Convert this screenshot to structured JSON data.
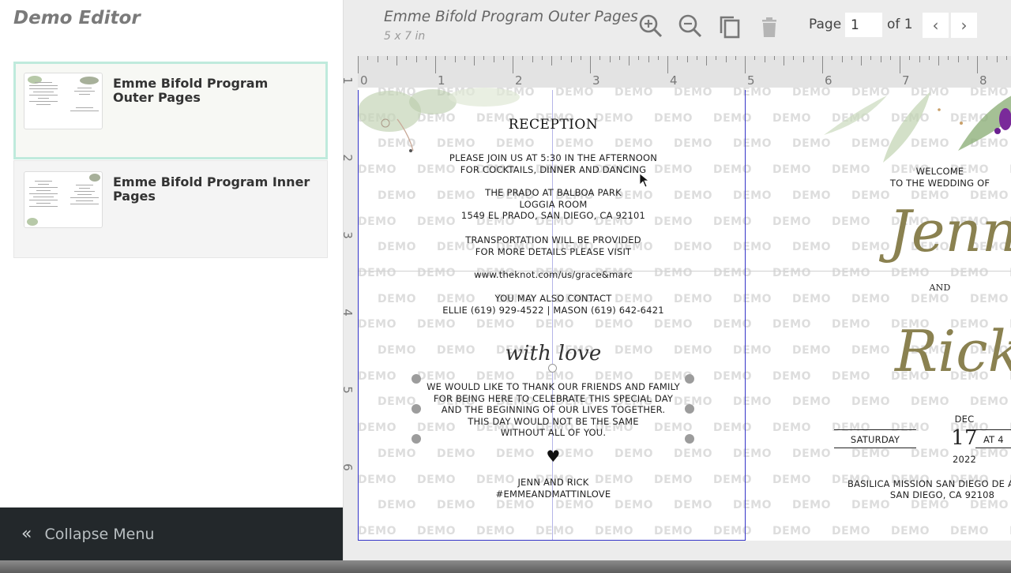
{
  "sidebar": {
    "title": "Demo Editor",
    "designs": [
      {
        "name": "Emme Bifold Program Outer Pages",
        "active": true
      },
      {
        "name": "Emme Bifold Program Inner Pages",
        "active": false
      }
    ],
    "collapse_label": "Collapse Menu",
    "collapse_icon": "double-chevron-left-icon"
  },
  "toolbar": {
    "doc_title": "Emme Bifold Program Outer Pages",
    "doc_size": "5 x 7 in",
    "icons": [
      "zoom-in-icon",
      "zoom-out-icon",
      "duplicate-icon",
      "trash-icon"
    ],
    "page_label": "Page",
    "page_value": "1",
    "page_of": "of 1",
    "prev": "‹",
    "next": "›"
  },
  "ruler": {
    "h_labels": [
      "0",
      "1",
      "2",
      "3",
      "4",
      "5",
      "6",
      "7",
      "8"
    ],
    "v_labels": [
      "1",
      "2",
      "3",
      "4",
      "5",
      "6"
    ]
  },
  "watermark": "DEMO",
  "left_page": {
    "heading": "RECEPTION",
    "invite": [
      "PLEASE JOIN US AT 5:30 IN THE AFTERNOON",
      "FOR COCKTAILS, DINNER AND DANCING"
    ],
    "venue": [
      "THE PRADO AT BALBOA PARK",
      "LOGGIA ROOM",
      "1549 EL PRADO, SAN DIEGO, CA 92101"
    ],
    "transport": [
      "TRANSPORTATION WILL BE PROVIDED",
      "FOR MORE DETAILS PLEASE VISIT"
    ],
    "url": "www.theknot.com/us/grace&marc",
    "contact": [
      "YOU MAY ALSO CONTACT",
      "ELLIE (619) 929-4522 | MASON (619) 642-6421"
    ],
    "script": "with love",
    "thanks": [
      "WE WOULD LIKE TO THANK OUR FRIENDS AND FAMILY",
      "FOR BEING HERE TO CELEBRATE THIS SPECIAL DAY",
      "AND THE BEGINNING OF OUR LIVES TOGETHER.",
      "THIS DAY WOULD NOT BE THE SAME",
      "WITHOUT ALL OF YOU."
    ],
    "heart": "♥",
    "signature": [
      "JENN AND RICK",
      "#EMMEANDMATTINLOVE"
    ]
  },
  "right_page": {
    "welcome": [
      "WELCOME",
      "TO THE WEDDING OF"
    ],
    "name1": "Jenn",
    "and": "AND",
    "name2": "Rick",
    "weekday": "SATURDAY",
    "month": "DEC",
    "day": "17",
    "year": "2022",
    "time_partial": "AT 4",
    "venue": [
      "BASILICA MISSION SAN DIEGO DE ALCALA",
      "SAN DIEGO, CA 92108"
    ]
  }
}
